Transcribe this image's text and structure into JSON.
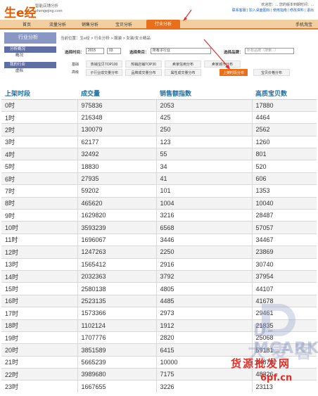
{
  "header": {
    "logo": "生e经",
    "logo_sub": "智能店铺分析",
    "logo_url_text": "shengejing.com",
    "top_links_line1": "欢迎您：... 您的版本到期时间：...",
    "top_links_line2": "联系客服 | 加入桌面图标 | 使用指南 | 修改资料 | 退出"
  },
  "nav": {
    "items": [
      "首页",
      "流量分析",
      "销售分析",
      "宝贝分析",
      "行业分析"
    ],
    "right": "手机淘宝"
  },
  "sidebar": {
    "title": "行业分析",
    "sections": [
      {
        "label": "分析概况",
        "items": [
          "概况"
        ]
      },
      {
        "label": "我的行业",
        "items": [
          "虚拟"
        ]
      }
    ]
  },
  "breadcrumb": "当前位置：生e经 > 行业分析 > 服装 > 女装/女士精品",
  "filters": {
    "time_label": "选择时间：",
    "year": "2015",
    "month": "03",
    "category_label": "选择类目：",
    "category_value": "所有子行业",
    "brand_label": "选择品牌：",
    "brand_placeholder": "所有品牌（搜索...）"
  },
  "subtabs": {
    "row1_label": "基础",
    "row1": [
      "热销宝贝TOP100",
      "热销店铺TOP30",
      "卖家信用分布",
      "卖家城市分布"
    ],
    "row2_label": "高级",
    "row2": [
      "子行业成交量分布",
      "品牌成交量分布",
      "属性成交量分布",
      "上架时段分布",
      "宝贝价格分布"
    ]
  },
  "table": {
    "columns": [
      "上架时段",
      "成交量",
      "销售额指数",
      "高质宝贝数"
    ],
    "rows": [
      [
        "0时",
        "975836",
        "2053",
        "17880"
      ],
      [
        "1时",
        "216348",
        "425",
        "4464"
      ],
      [
        "2时",
        "130079",
        "250",
        "2562"
      ],
      [
        "3时",
        "62177",
        "123",
        "1260"
      ],
      [
        "4时",
        "32492",
        "55",
        "801"
      ],
      [
        "5时",
        "18830",
        "34",
        "520"
      ],
      [
        "6时",
        "27935",
        "41",
        "606"
      ],
      [
        "7时",
        "59202",
        "101",
        "1353"
      ],
      [
        "8时",
        "465620",
        "1004",
        "10040"
      ],
      [
        "9时",
        "1629820",
        "3216",
        "28487"
      ],
      [
        "10时",
        "3593239",
        "6568",
        "57057"
      ],
      [
        "11时",
        "1696067",
        "3446",
        "34467"
      ],
      [
        "12时",
        "1247263",
        "2250",
        "23869"
      ],
      [
        "13时",
        "1565412",
        "2916",
        "30740"
      ],
      [
        "14时",
        "2032363",
        "3792",
        "37954"
      ],
      [
        "15时",
        "2580138",
        "4805",
        "44107"
      ],
      [
        "16时",
        "2523135",
        "4485",
        "41678"
      ],
      [
        "17时",
        "1573366",
        "2973",
        "29461"
      ],
      [
        "18时",
        "1102124",
        "1912",
        "21835"
      ],
      [
        "19时",
        "1707776",
        "2820",
        "25068"
      ],
      [
        "20时",
        "3851589",
        "6415",
        "59181"
      ],
      [
        "21时",
        "5665239",
        "10000",
        "84878"
      ],
      [
        "22时",
        "3989680",
        "7175",
        "48326"
      ],
      [
        "23时",
        "1667655",
        "3226",
        "23113"
      ]
    ]
  },
  "watermark": {
    "brand": "D-MCARK",
    "brand_cn": "大 麦 客",
    "cn": "货源批发网",
    "url": "6pf.cn"
  },
  "colors": {
    "accent_orange": "#e8701a",
    "nav_bg": "#f2cfa0",
    "sidebar_header": "#8a97c2",
    "table_header_text": "#1f6ea3",
    "watermark_red": "#e0302a"
  }
}
